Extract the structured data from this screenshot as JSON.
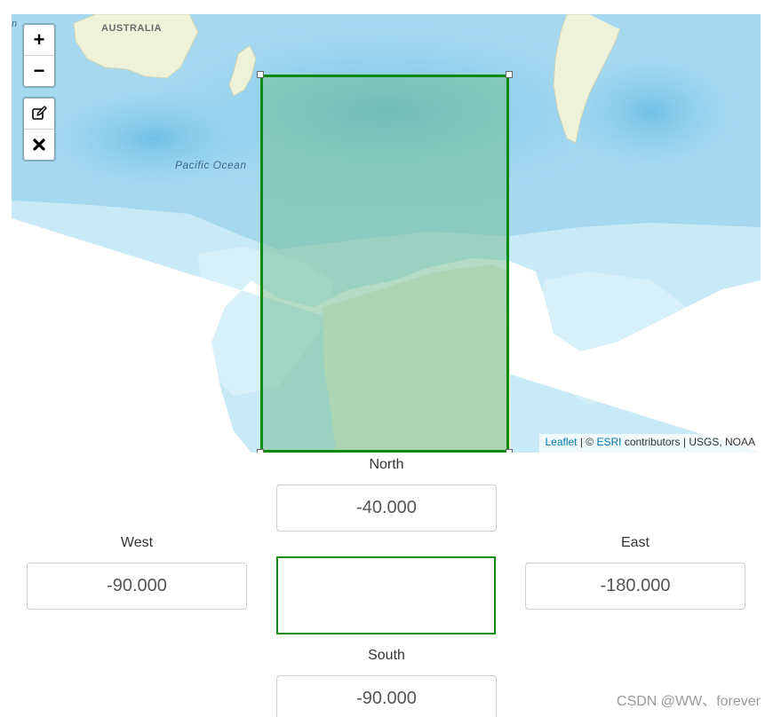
{
  "map": {
    "zoom_in_label": "+",
    "zoom_out_label": "−",
    "tools": [
      {
        "name": "edit-layers",
        "icon": "edit-icon"
      },
      {
        "name": "delete-layers",
        "icon": "close-icon"
      }
    ],
    "labels": {
      "australia": "AUSTRALIA",
      "pacific": "Pacific Ocean",
      "edge_fragment": "n"
    },
    "attribution": {
      "leaflet": "Leaflet",
      "separator1": " | © ",
      "esri": "ESRI",
      "rest": " contributors | USGS, NOAA"
    },
    "colors": {
      "ocean": "#a6d9f0",
      "land": "#eef2d8",
      "bbox_stroke": "#0b8a0b",
      "bbox_fill": "#74be96"
    }
  },
  "form": {
    "north": {
      "label": "North",
      "value": "-40.000"
    },
    "west": {
      "label": "West",
      "value": "-90.000"
    },
    "east": {
      "label": "East",
      "value": "-180.000"
    },
    "south": {
      "label": "South",
      "value": "-90.000"
    }
  },
  "watermark": "CSDN @WW、forever"
}
